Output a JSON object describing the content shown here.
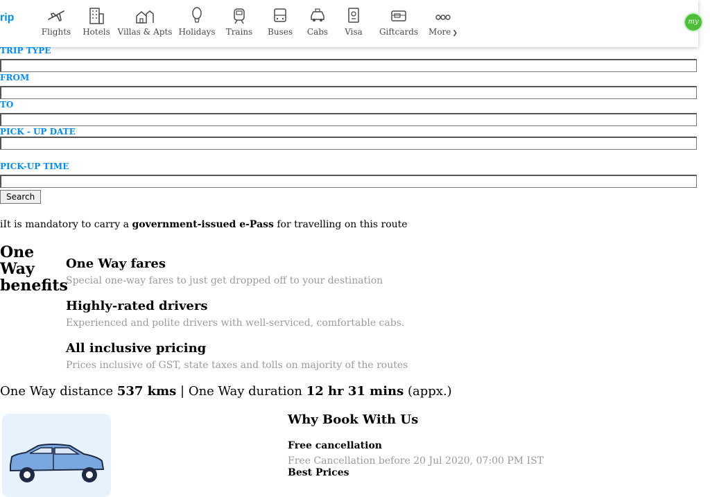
{
  "header": {
    "brand": "rip",
    "nav": [
      {
        "label": "Flights",
        "icon": "plane-icon"
      },
      {
        "label": "Hotels",
        "icon": "hotel-icon"
      },
      {
        "label": "Villas & Apts",
        "icon": "villa-icon"
      },
      {
        "label": "Holidays",
        "icon": "balloon-icon"
      },
      {
        "label": "Trains",
        "icon": "train-icon"
      },
      {
        "label": "Buses",
        "icon": "bus-icon"
      },
      {
        "label": "Cabs",
        "icon": "cab-icon"
      },
      {
        "label": "Visa",
        "icon": "passport-icon"
      },
      {
        "label": "Giftcards",
        "icon": "giftcard-icon"
      },
      {
        "label": "More",
        "icon": "more-icon"
      }
    ],
    "avatar_text": "my"
  },
  "form": {
    "trip_type_label": "TRIP TYPE",
    "from_label": "FROM",
    "to_label": "TO",
    "pickup_date_label": "PICK - UP DATE",
    "pickup_time_label": "PICK-UP TIME",
    "search_label": "Search"
  },
  "notice": {
    "prefix": "iIt is mandatory to carry a ",
    "bold": "government-issued e-Pass",
    "suffix": " for travelling on this route"
  },
  "benefits": {
    "title": "One Way benefits",
    "items": [
      {
        "title": "One Way fares",
        "desc": "Special one-way fares to just get dropped off to your destination"
      },
      {
        "title": "Highly-rated drivers",
        "desc": "Experienced and polite drivers with well-serviced, comfortable cabs."
      },
      {
        "title": "All inclusive pricing",
        "desc": "Prices inclusive of GST, state taxes and tolls on majority of the routes"
      }
    ]
  },
  "route": {
    "distance_prefix": "One Way distance ",
    "distance": "537 kms",
    "separator": " | One Way duration ",
    "duration": "12 hr 31 mins",
    "suffix": " (appx.)"
  },
  "why": {
    "title": "Why Book With Us",
    "items": [
      {
        "title": "Free cancellation",
        "desc": "Free Cancellation before 20 Jul 2020, 07:00 PM IST"
      },
      {
        "title": "Best Prices",
        "desc": ""
      }
    ]
  },
  "colors": {
    "accent": "#008cff",
    "muted": "#9b9b9b",
    "car": "#7aa7e0"
  }
}
